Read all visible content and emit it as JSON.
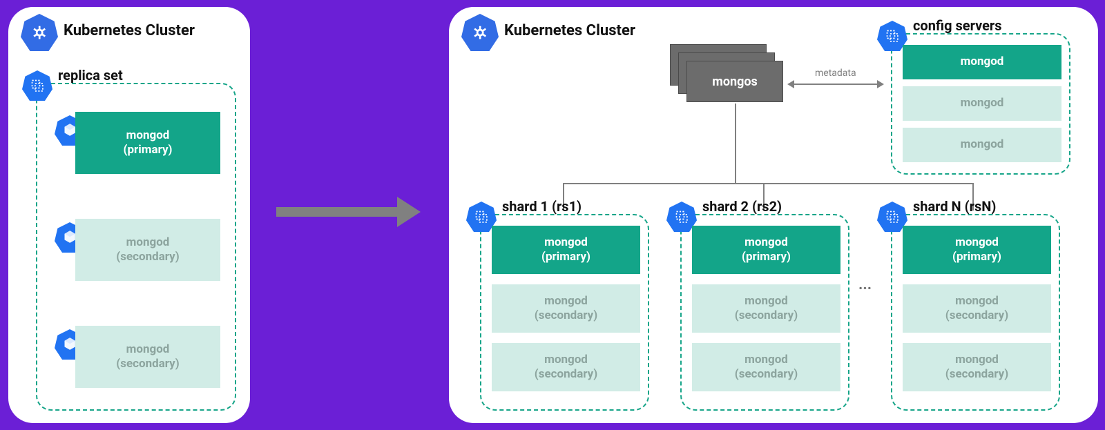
{
  "left_cluster": {
    "title": "Kubernetes Cluster",
    "replica_set": {
      "label": "replica set",
      "nodes": [
        {
          "l1": "mongod",
          "l2": "(primary)"
        },
        {
          "l1": "mongod",
          "l2": "(secondary)"
        },
        {
          "l1": "mongod",
          "l2": "(secondary)"
        }
      ]
    }
  },
  "right_cluster": {
    "title": "Kubernetes Cluster",
    "mongos_label": "mongos",
    "metadata_label": "metadata",
    "config_servers": {
      "label": "config servers",
      "nodes": [
        "mongod",
        "mongod",
        "mongod"
      ]
    },
    "shards": [
      {
        "label": "shard 1 (rs1)",
        "nodes": [
          {
            "l1": "mongod",
            "l2": "(primary)"
          },
          {
            "l1": "mongod",
            "l2": "(secondary)"
          },
          {
            "l1": "mongod",
            "l2": "(secondary)"
          }
        ]
      },
      {
        "label": "shard 2 (rs2)",
        "nodes": [
          {
            "l1": "mongod",
            "l2": "(primary)"
          },
          {
            "l1": "mongod",
            "l2": "(secondary)"
          },
          {
            "l1": "mongod",
            "l2": "(secondary)"
          }
        ]
      },
      {
        "label": "shard N (rsN)",
        "nodes": [
          {
            "l1": "mongod",
            "l2": "(primary)"
          },
          {
            "l1": "mongod",
            "l2": "(secondary)"
          },
          {
            "l1": "mongod",
            "l2": "(secondary)"
          }
        ]
      }
    ],
    "ellipsis": "..."
  }
}
